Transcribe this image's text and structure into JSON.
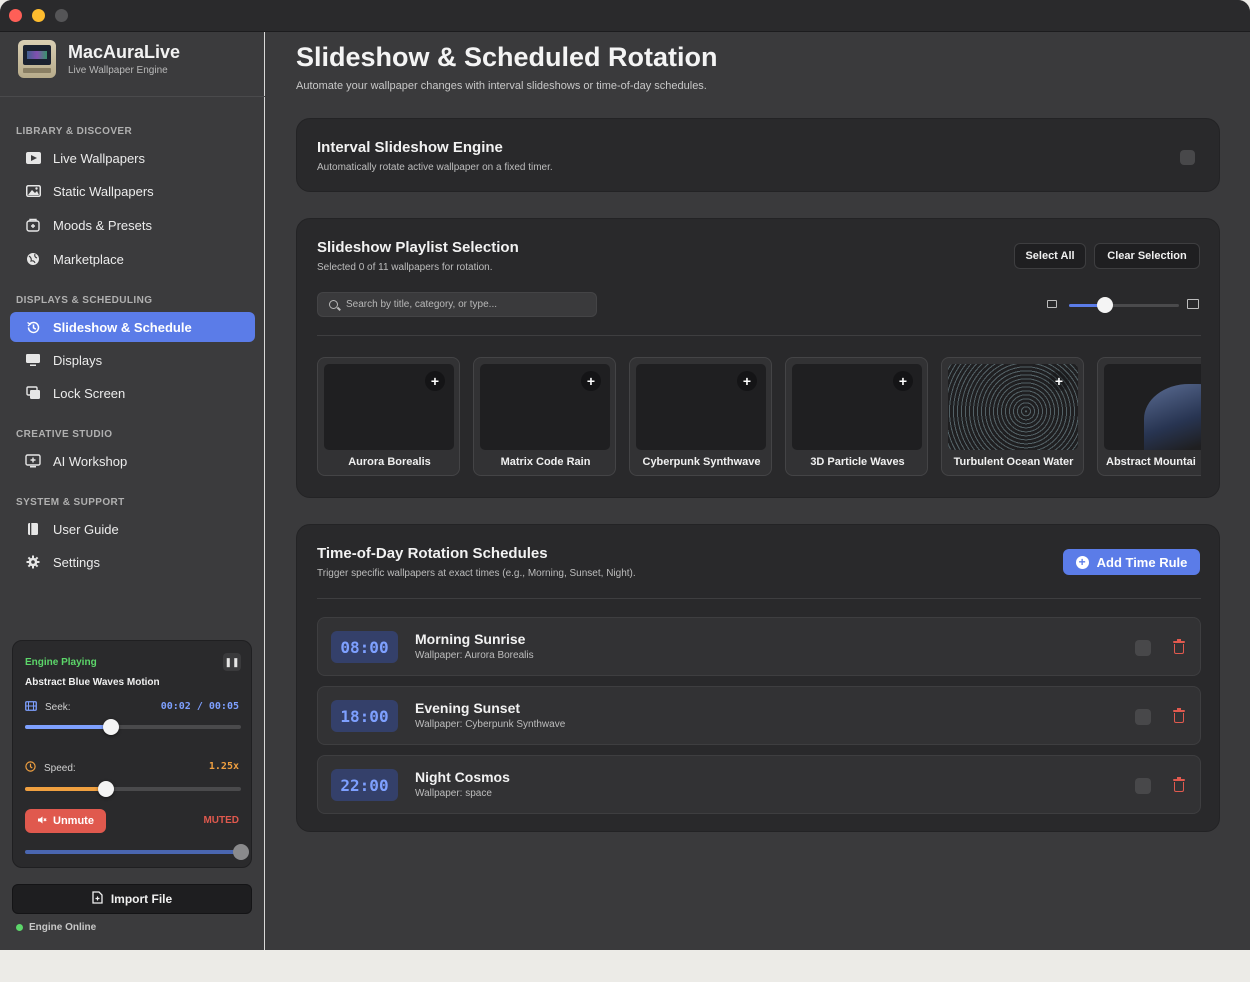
{
  "app": {
    "name": "MacAuraLive",
    "subtitle": "Live Wallpaper Engine"
  },
  "sidebar": {
    "sections": [
      {
        "label": "LIBRARY & DISCOVER"
      },
      {
        "label": "DISPLAYS & SCHEDULING"
      },
      {
        "label": "CREATIVE STUDIO"
      },
      {
        "label": "SYSTEM & SUPPORT"
      }
    ],
    "items": [
      {
        "label": "Live Wallpapers",
        "icon": "play-icon"
      },
      {
        "label": "Static Wallpapers",
        "icon": "image-icon"
      },
      {
        "label": "Moods & Presets",
        "icon": "preset-icon"
      },
      {
        "label": "Marketplace",
        "icon": "globe-icon"
      },
      {
        "label": "Slideshow & Schedule",
        "icon": "history-icon",
        "active": true
      },
      {
        "label": "Displays",
        "icon": "display-icon"
      },
      {
        "label": "Lock Screen",
        "icon": "lock-screen-icon"
      },
      {
        "label": "AI Workshop",
        "icon": "ai-icon"
      },
      {
        "label": "User Guide",
        "icon": "book-icon"
      },
      {
        "label": "Settings",
        "icon": "gear-icon"
      }
    ]
  },
  "player": {
    "status": "Engine Playing",
    "title": "Abstract Blue Waves Motion",
    "seek_label": "Seek:",
    "time": "00:02 / 00:05",
    "seek_progress": 0.4,
    "speed_label": "Speed:",
    "speed_value": "1.25x",
    "speed_progress": 0.375,
    "unmute_label": "Unmute",
    "muted_label": "MUTED",
    "volume_progress": 1.0
  },
  "import_button": "Import File",
  "engine_status": "Engine Online",
  "page": {
    "title": "Slideshow & Scheduled Rotation",
    "subtitle": "Automate your wallpaper changes with interval slideshows or time-of-day schedules."
  },
  "interval_card": {
    "title": "Interval Slideshow Engine",
    "subtitle": "Automatically rotate active wallpaper on a fixed timer."
  },
  "playlist_card": {
    "title": "Slideshow Playlist Selection",
    "subtitle": "Selected 0 of 11 wallpapers for rotation.",
    "select_all": "Select All",
    "clear_selection": "Clear Selection",
    "search_placeholder": "Search by title, category, or type...",
    "thumb_size_progress": 0.33,
    "wallpapers": [
      {
        "name": "Aurora Borealis"
      },
      {
        "name": "Matrix Code Rain"
      },
      {
        "name": "Cyberpunk Synthwave"
      },
      {
        "name": "3D Particle Waves"
      },
      {
        "name": "Turbulent Ocean Water"
      },
      {
        "name": "Abstract Mountai"
      }
    ]
  },
  "schedule_card": {
    "title": "Time-of-Day Rotation Schedules",
    "subtitle": "Trigger specific wallpapers at exact times (e.g., Morning, Sunset, Night).",
    "add_rule": "Add Time Rule",
    "rules": [
      {
        "time": "08:00",
        "name": "Morning Sunrise",
        "wallpaper": "Wallpaper: Aurora Borealis"
      },
      {
        "time": "18:00",
        "name": "Evening Sunset",
        "wallpaper": "Wallpaper: Cyberpunk Synthwave"
      },
      {
        "time": "22:00",
        "name": "Night Cosmos",
        "wallpaper": "Wallpaper: space"
      }
    ]
  },
  "colors": {
    "accent": "#5b7ce8",
    "playing": "#5cd66a",
    "danger": "#e0594e",
    "speed": "#f0a040"
  }
}
